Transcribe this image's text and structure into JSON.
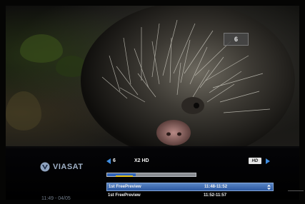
{
  "video": {
    "channel_badge": "6"
  },
  "osd": {
    "logo_text": "VIASAT",
    "clock": "11:49  -  04/05",
    "channel_number": "6",
    "channel_name": "X2 HD",
    "hd_badge": "HD",
    "progress": 0.32,
    "programs": [
      {
        "title": "1st FreePreview",
        "time": "11:48-11:52",
        "selected": true
      },
      {
        "title": "1st FreePreview",
        "time": "11:52-11:57",
        "selected": false
      }
    ]
  },
  "colors": {
    "accent": "#2f63b8",
    "progress_marker": "#e8c21a",
    "selected_row": "#3d6cb3"
  }
}
